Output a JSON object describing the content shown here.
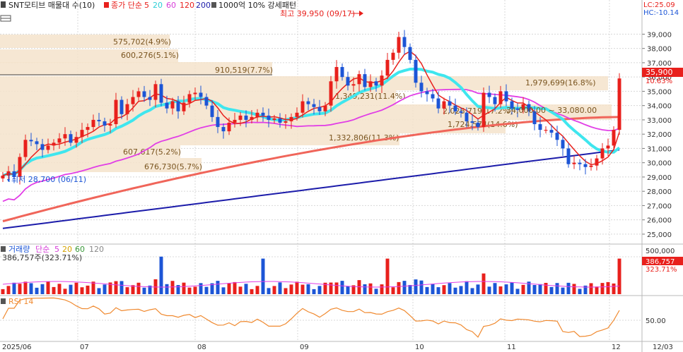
{
  "header": {
    "title": "SNT모티브 매물대 수(10)",
    "ma_label": "종가 단순",
    "ma_periods": [
      "5",
      "20",
      "60",
      "120",
      "200"
    ],
    "extra_label": "1000억 10% 강세패턴",
    "lc_label": "LC:25.09",
    "hc_label": "HC:-10.14"
  },
  "price_panel": {
    "high_marker": "최고 39,950 (09/17)",
    "low_marker": "최저 28,700 (06/11)",
    "current_price": "35,900",
    "current_change": "10.63%",
    "range_label": "34,000.00 ~ 33,080.00",
    "y_ticks": [
      "39,000",
      "38,000",
      "37,000",
      "36,000",
      "35,000",
      "34,000",
      "33,000",
      "32,000",
      "31,000",
      "30,000",
      "29,000",
      "28,000",
      "27,000",
      "26,000",
      "25,000"
    ],
    "volume_profile": [
      {
        "label": "575,702(4.9%)"
      },
      {
        "label": "600,276(5.1%)"
      },
      {
        "label": "910,519(7.7%)"
      },
      {
        "label": "1,979,699(16.8%)"
      },
      {
        "label": "1,349,231(11.4%)"
      },
      {
        "label": "2,026,719(17.2%)"
      },
      {
        "label": "1,724,574(14.6%)"
      },
      {
        "label": "1,332,806(11.3%)"
      },
      {
        "label": "607,617(5.2%)"
      },
      {
        "label": "676,730(5.7%)"
      }
    ]
  },
  "volume_panel": {
    "title": "거래량",
    "ma_label": "단순",
    "ma_periods": [
      "5",
      "20",
      "60",
      "120"
    ],
    "current_volume": "386,757주(323.71%)",
    "y_tick": "500,000",
    "badge_value": "386,757",
    "badge_pct": "323.71%"
  },
  "rsi_panel": {
    "title": "RSI 14",
    "y_tick": "50.00"
  },
  "x_axis": {
    "labels": [
      "2025/06",
      "07",
      "08",
      "09",
      "10",
      "11",
      "12",
      "12/03"
    ]
  },
  "colors": {
    "up": "#e8201c",
    "down": "#1c55d6",
    "ma5": "#e8201c",
    "ma20": "#3fe6ee",
    "ma60": "#e13ee6",
    "ma120": "#f0655a",
    "ma200": "#1c1caa",
    "profile": "#f5e3cb",
    "rsi": "#f08a30"
  },
  "chart_data": {
    "type": "candlestick",
    "title": "SNT모티브 매물대 수(10)",
    "period": "2025/06 – 2025/12",
    "price_range": [
      25000,
      40000
    ],
    "highest": {
      "value": 39950,
      "date": "09/17"
    },
    "lowest": {
      "value": 28700,
      "date": "06/11"
    },
    "close_series": [
      29100,
      29400,
      29000,
      30400,
      31600,
      31500,
      31300,
      30900,
      31200,
      31400,
      31700,
      32000,
      31400,
      31800,
      32300,
      32500,
      33000,
      32900,
      32600,
      32700,
      34400,
      33400,
      34100,
      34600,
      35000,
      34600,
      34400,
      35500,
      34200,
      33800,
      34300,
      33600,
      34200,
      34800,
      34900,
      34600,
      34000,
      33200,
      32500,
      32200,
      32800,
      33000,
      33300,
      33000,
      33200,
      33500,
      33300,
      33000,
      33100,
      32800,
      32900,
      33200,
      33500,
      34300,
      34100,
      33900,
      33600,
      34000,
      35700,
      36700,
      36000,
      35400,
      35500,
      36200,
      35300,
      35700,
      35400,
      36100,
      37200,
      37700,
      38800,
      38100,
      37200,
      35600,
      35000,
      34800,
      34500,
      33800,
      34300,
      34000,
      33600,
      33500,
      32900,
      32800,
      32500,
      34900,
      34600,
      34100,
      35000,
      34300,
      33800,
      33700,
      34100,
      33600,
      32700,
      32300,
      32300,
      32100,
      31600,
      31000,
      29900,
      30000,
      29900,
      29700,
      29800,
      30300,
      31000,
      31200,
      32300,
      35900
    ],
    "moving_averages": [
      {
        "name": "5",
        "values": "derived from close_series"
      },
      {
        "name": "20",
        "from": 30100,
        "to": 31300,
        "peak": 35800
      },
      {
        "name": "60",
        "from": 28600,
        "to": 33700,
        "peak": 34700
      },
      {
        "name": "120",
        "from": 25900,
        "to": 33200
      },
      {
        "name": "200",
        "from": 25400,
        "to": 30900
      }
    ],
    "volume_profile": [
      {
        "volume": 575702,
        "percent": 4.9
      },
      {
        "volume": 600276,
        "percent": 5.1
      },
      {
        "volume": 910519,
        "percent": 7.7
      },
      {
        "volume": 1979699,
        "percent": 16.8
      },
      {
        "volume": 1349231,
        "percent": 11.4
      },
      {
        "volume": 2026719,
        "percent": 17.2
      },
      {
        "volume": 1724574,
        "percent": 14.6
      },
      {
        "volume": 1332806,
        "percent": 11.3
      },
      {
        "volume": 607617,
        "percent": 5.2
      },
      {
        "volume": 676730,
        "percent": 5.7
      }
    ],
    "last_volume": 386757,
    "last_volume_ratio_pct": 323.71,
    "last_change_pct": 10.63,
    "volume_axis_tick": 500000,
    "rsi_axis_tick": 50.0
  }
}
